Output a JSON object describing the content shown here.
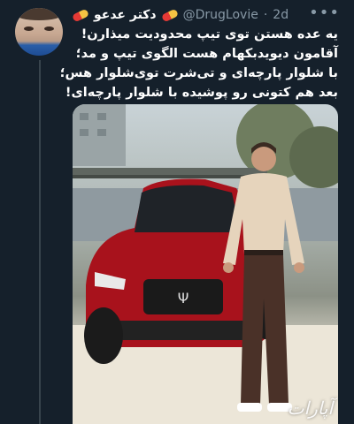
{
  "tweet": {
    "display_name": "دکتر عدعو",
    "handle": "@DrugLovie",
    "separator": "·",
    "time": "2d",
    "more_icon": "more-icon",
    "lines": [
      "یه عده هستن توی تیپ محدودیت میذارن!",
      "آقامون دیویدبکهام هست الگوی تیپ و مد؛",
      "با شلوار پارچه‌ای و تی‌شرت توی‌شلوار هس؛",
      "بعد هم کتونی رو پوشیده با شلوار پارچه‌ای!"
    ]
  },
  "media": {
    "watermark": "آپارات"
  }
}
